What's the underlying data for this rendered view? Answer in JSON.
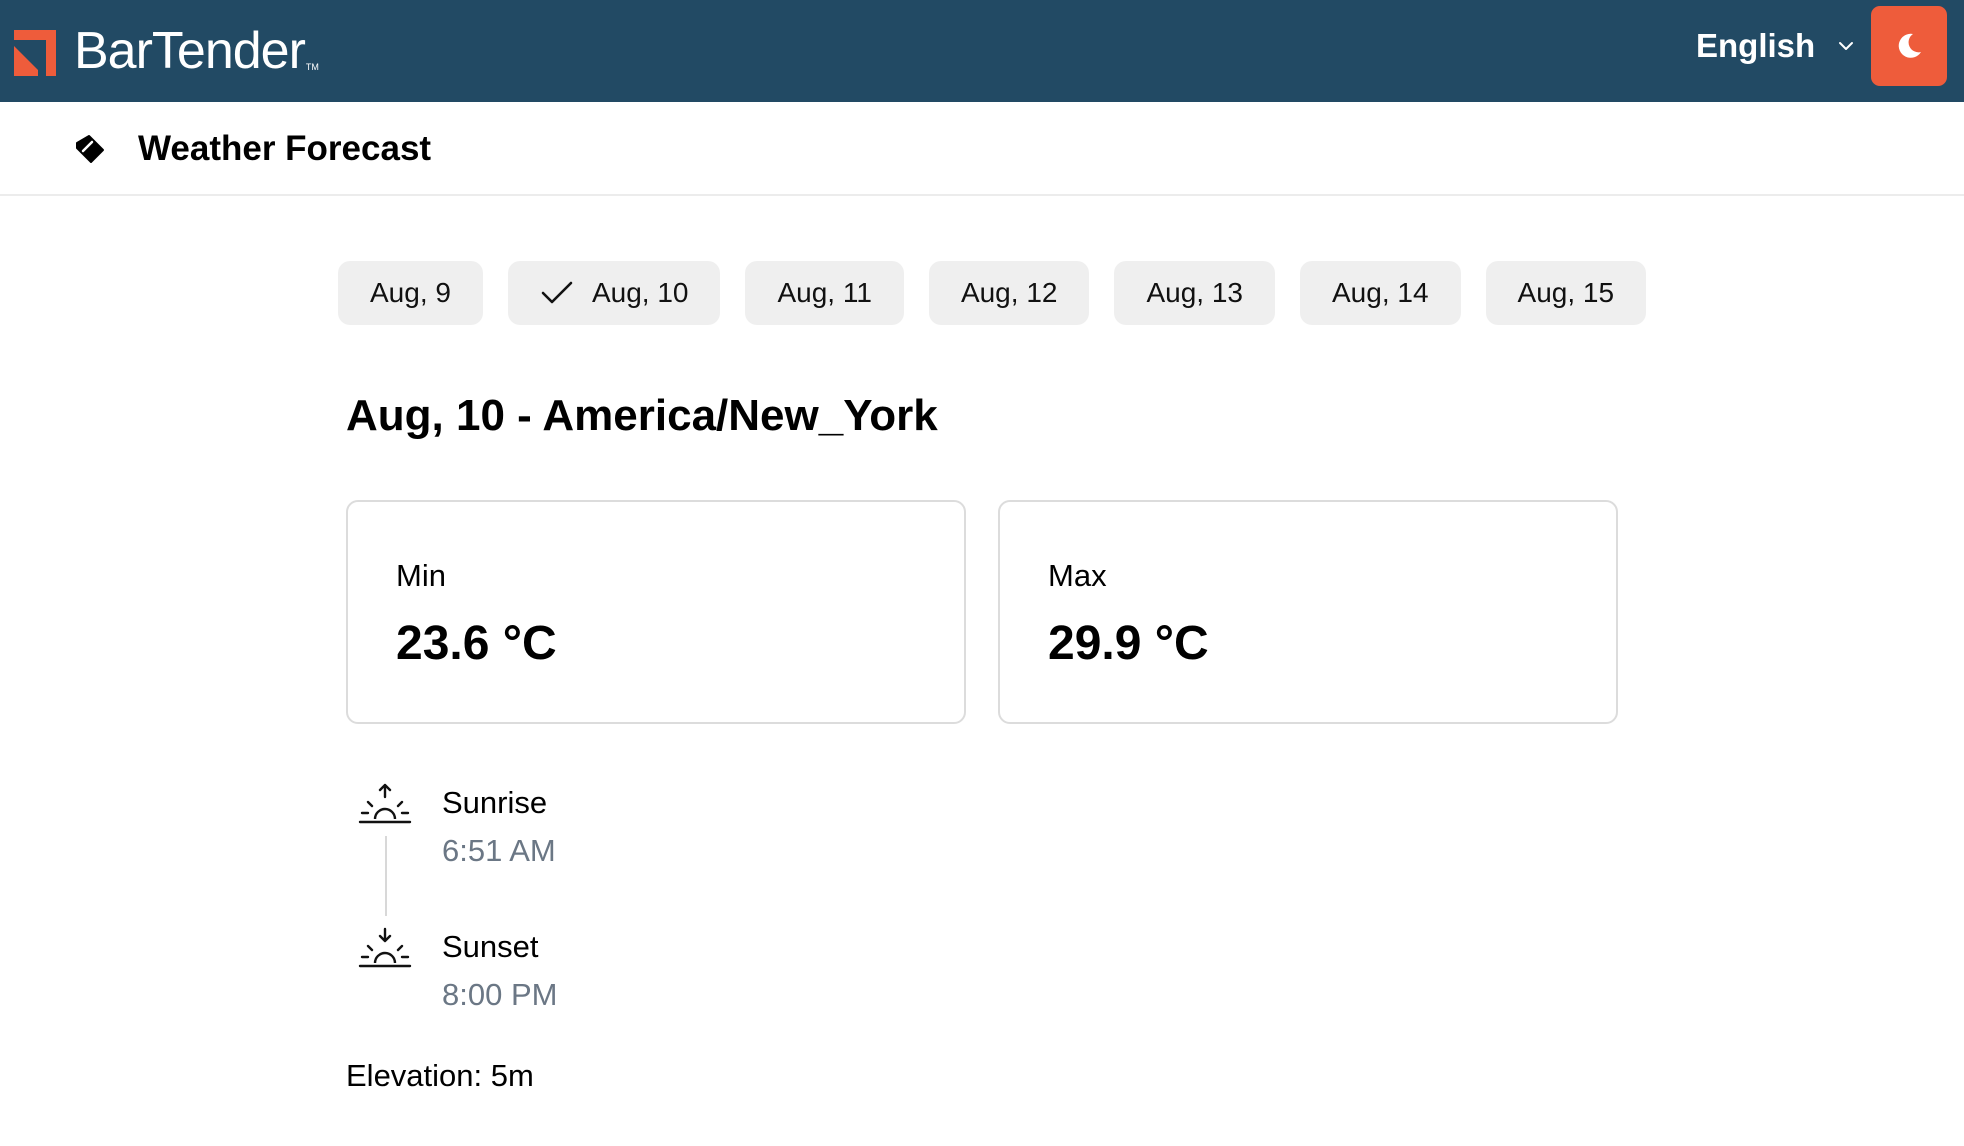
{
  "header": {
    "brand": "BarTender",
    "brand_tm": "TM",
    "language": "English",
    "theme_icon": "moon-icon",
    "colors": {
      "bar": "#224a64",
      "accent": "#ee5c3b"
    }
  },
  "subheader": {
    "icon": "tag-icon",
    "title": "Weather Forecast"
  },
  "dates": [
    {
      "label": "Aug, 9",
      "selected": false
    },
    {
      "label": "Aug, 10",
      "selected": true
    },
    {
      "label": "Aug, 11",
      "selected": false
    },
    {
      "label": "Aug, 12",
      "selected": false
    },
    {
      "label": "Aug, 13",
      "selected": false
    },
    {
      "label": "Aug, 14",
      "selected": false
    },
    {
      "label": "Aug, 15",
      "selected": false
    }
  ],
  "forecast": {
    "heading": "Aug, 10 - America/New_York",
    "min": {
      "label": "Min",
      "value": "23.6 °C"
    },
    "max": {
      "label": "Max",
      "value": "29.9 °C"
    },
    "sunrise": {
      "label": "Sunrise",
      "time": "6:51 AM",
      "icon": "sunrise-icon"
    },
    "sunset": {
      "label": "Sunset",
      "time": "8:00 PM",
      "icon": "sunset-icon"
    },
    "elevation": "Elevation: 5m"
  }
}
